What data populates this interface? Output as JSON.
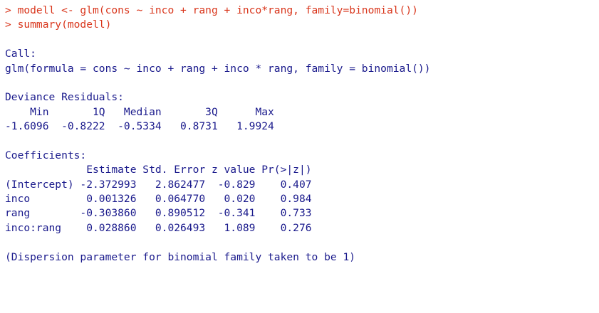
{
  "console": {
    "accent_input_color": "#d9361c",
    "output_color": "#1a1a8c",
    "lines": [
      {
        "type": "input",
        "text": "> modell <- glm(cons ~ inco + rang + inco*rang, family=binomial())"
      },
      {
        "type": "input",
        "text": "> summary(modell)"
      },
      {
        "type": "output",
        "text": ""
      },
      {
        "type": "output",
        "text": "Call:"
      },
      {
        "type": "output",
        "text": "glm(formula = cons ~ inco + rang + inco * rang, family = binomial())"
      },
      {
        "type": "output",
        "text": ""
      },
      {
        "type": "output",
        "text": "Deviance Residuals:"
      },
      {
        "type": "output",
        "text": "    Min       1Q   Median       3Q      Max  "
      },
      {
        "type": "output",
        "text": "-1.6096  -0.8222  -0.5334   0.8731   1.9924  "
      },
      {
        "type": "output",
        "text": ""
      },
      {
        "type": "output",
        "text": "Coefficients:"
      },
      {
        "type": "output",
        "text": "             Estimate Std. Error z value Pr(>|z|)"
      },
      {
        "type": "output",
        "text": "(Intercept) -2.372993   2.862477  -0.829    0.407"
      },
      {
        "type": "output",
        "text": "inco         0.001326   0.064770   0.020    0.984"
      },
      {
        "type": "output",
        "text": "rang        -0.303860   0.890512  -0.341    0.733"
      },
      {
        "type": "output",
        "text": "inco:rang    0.028860   0.026493   1.089    0.276"
      },
      {
        "type": "output",
        "text": ""
      },
      {
        "type": "output",
        "text": "(Dispersion parameter for binomial family taken to be 1)"
      }
    ]
  }
}
